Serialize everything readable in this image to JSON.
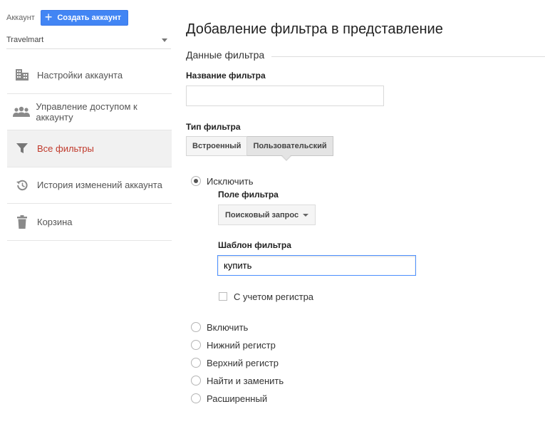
{
  "sidebar": {
    "account_label": "Аккаунт",
    "create_account_label": "Создать аккаунт",
    "account_name": "Travelmart",
    "items": [
      {
        "label": "Настройки аккаунта",
        "icon": "building-icon",
        "active": false
      },
      {
        "label": "Управление доступом к аккаунту",
        "icon": "users-icon",
        "active": false
      },
      {
        "label": "Все фильтры",
        "icon": "filter-icon",
        "active": true
      },
      {
        "label": "История изменений аккаунта",
        "icon": "history-icon",
        "active": false
      },
      {
        "label": "Корзина",
        "icon": "trash-icon",
        "active": false
      }
    ]
  },
  "main": {
    "title": "Добавление фильтра в представление",
    "section_title": "Данные фильтра",
    "filter_name_label": "Название фильтра",
    "filter_name_value": "",
    "filter_type_label": "Тип фильтра",
    "type_tabs": [
      {
        "label": "Встроенный",
        "active": false
      },
      {
        "label": "Пользовательский",
        "active": true
      }
    ],
    "options": {
      "exclude": "Исключить",
      "include": "Включить",
      "lowercase": "Нижний регистр",
      "uppercase": "Верхний регистр",
      "search_replace": "Найти и заменить",
      "advanced": "Расширенный"
    },
    "selected_option": "exclude",
    "filter_field_label": "Поле фильтра",
    "filter_field_value": "Поисковый запрос",
    "filter_pattern_label": "Шаблон фильтра",
    "filter_pattern_value": "купить",
    "case_sensitive_label": "С учетом регистра",
    "case_sensitive": false
  },
  "colors": {
    "accent_blue": "#4285f4",
    "active_nav_text": "#c0392b",
    "focus_border": "#4d90fe"
  }
}
